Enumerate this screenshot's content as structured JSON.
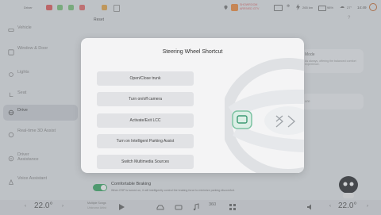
{
  "statusbar": {
    "user": "Driver",
    "notice_title": "SHOWROOM",
    "notice_sub": "ARRIVED GTV",
    "range": "265 km",
    "battery": "98%",
    "outside_temp": "27°",
    "time": "14:49"
  },
  "reset_label": "Reset",
  "sidebar": {
    "items": [
      {
        "label": "Vehicle",
        "icon": "car-icon"
      },
      {
        "label": "Window & Door",
        "icon": "door-icon"
      },
      {
        "label": "Lights",
        "icon": "light-icon"
      },
      {
        "label": "Seat",
        "icon": "seat-icon"
      },
      {
        "label": "Drive",
        "icon": "steering-icon"
      },
      {
        "label": "Real-time 3D Assist",
        "icon": "3d-assist-icon"
      },
      {
        "label": "Driver Assistance",
        "icon": "assist-icon"
      },
      {
        "label": "Voice Assistant",
        "icon": "voice-icon"
      }
    ]
  },
  "background": {
    "mode_title": "Mode",
    "mode_desc": "As always, offering the balanced comfort experience.",
    "card_label": "ure"
  },
  "brake": {
    "title": "Comfortable Braking",
    "desc": "When ESP is turned on, it will intelligently control the braking force to minimize parking discomfort."
  },
  "dialog": {
    "title": "Steering Wheel Shortcut",
    "options": [
      "Open/Close trunk",
      "Turn on/off camera",
      "Activate/Exit LCC",
      "Turn on Intelligent Parking Assist",
      "Switch Multimedia Sources"
    ]
  },
  "dock": {
    "left_temp": "22.0°",
    "right_temp": "22.0°",
    "media_title": "Multiple Songs",
    "media_sub": "Unknown Artist",
    "icons": [
      "play-icon",
      "car-home-icon",
      "car-settings-icon",
      "music-icon",
      "360-icon",
      "apps-icon",
      "volume-icon"
    ],
    "label_360": "360"
  }
}
